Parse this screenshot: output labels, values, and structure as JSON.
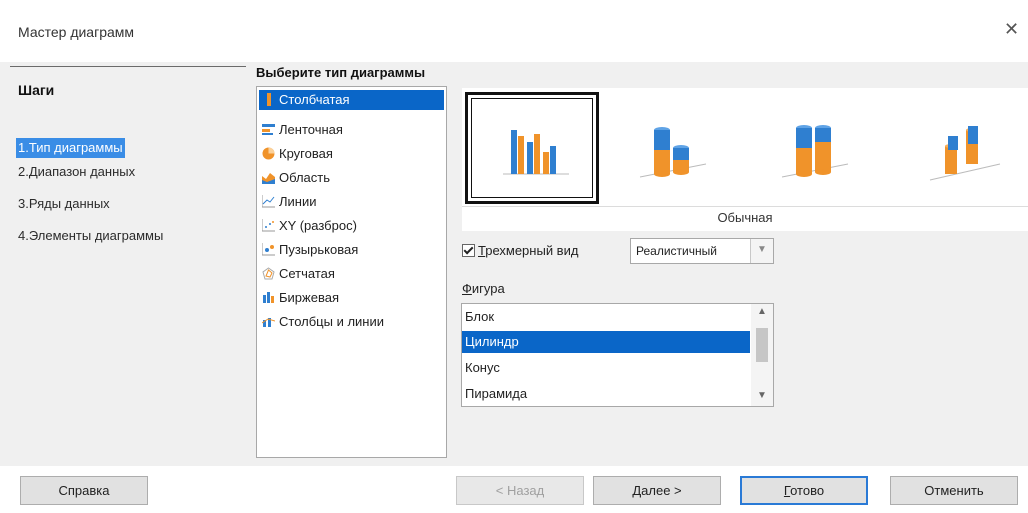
{
  "window": {
    "title": "Мастер диаграмм",
    "close_icon": "close-icon"
  },
  "steps": {
    "title": "Шаги",
    "items": [
      {
        "label": "1.Тип диаграммы",
        "active": true
      },
      {
        "label": "2.Диапазон данных",
        "active": false
      },
      {
        "label": "3.Ряды данных",
        "active": false
      },
      {
        "label": "4.Элементы диаграммы",
        "active": false
      }
    ]
  },
  "chart_type": {
    "title": "Выберите тип диаграммы",
    "types": [
      {
        "label": "Столбчатая",
        "icon": "column-chart-icon",
        "selected": true
      },
      {
        "label": "Ленточная",
        "icon": "bar-chart-icon",
        "selected": false
      },
      {
        "label": "Круговая",
        "icon": "pie-chart-icon",
        "selected": false
      },
      {
        "label": "Область",
        "icon": "area-chart-icon",
        "selected": false
      },
      {
        "label": "Линии",
        "icon": "line-chart-icon",
        "selected": false
      },
      {
        "label": "XY (разброс)",
        "icon": "xy-scatter-icon",
        "selected": false
      },
      {
        "label": "Пузырьковая",
        "icon": "bubble-chart-icon",
        "selected": false
      },
      {
        "label": "Сетчатая",
        "icon": "net-chart-icon",
        "selected": false
      },
      {
        "label": "Биржевая",
        "icon": "stock-chart-icon",
        "selected": false
      },
      {
        "label": "Столбцы и линии",
        "icon": "column-line-chart-icon",
        "selected": false
      }
    ]
  },
  "variants": {
    "selected_label": "Обычная",
    "items": [
      {
        "name": "normal",
        "selected": true
      },
      {
        "name": "stacked",
        "selected": false
      },
      {
        "name": "percent-stacked",
        "selected": false
      },
      {
        "name": "deep",
        "selected": false
      }
    ]
  },
  "three_d": {
    "label_underlined": "Т",
    "label_rest": "рехмерный вид",
    "checked": true,
    "style_value": "Реалистичный"
  },
  "shape": {
    "label_underlined": "Ф",
    "label_rest": "игура",
    "items": [
      {
        "label": "Блок",
        "selected": false
      },
      {
        "label": "Цилиндр",
        "selected": true
      },
      {
        "label": "Конус",
        "selected": false
      },
      {
        "label": "Пирамида",
        "selected": false
      }
    ]
  },
  "buttons": {
    "help": "Справка",
    "back": "< Назад",
    "next_underlined": "Д",
    "next_rest": "алее >",
    "finish_underlined": "Г",
    "finish_rest": "отово",
    "cancel": "Отменить"
  },
  "colors": {
    "accent": "#0a66c8",
    "step_highlight": "#3a8de6",
    "chart_orange": "#f0932a",
    "chart_blue": "#2f7fd0"
  }
}
